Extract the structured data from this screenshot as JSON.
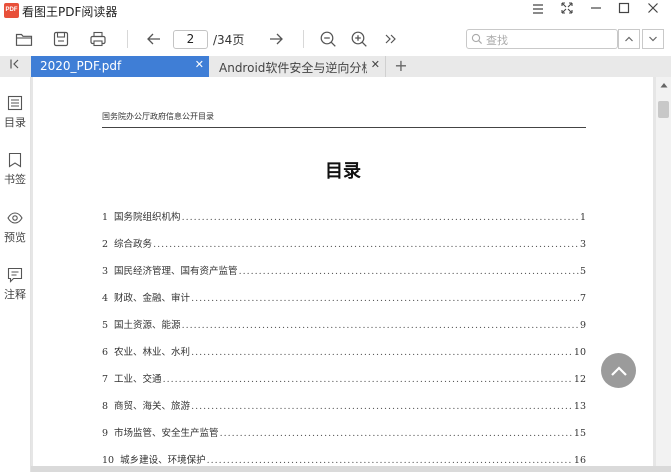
{
  "app": {
    "logo_text": "PDF",
    "title": "看图王PDF阅读器",
    "window_controls": [
      "menu-icon",
      "fullscreen-icon",
      "minimize-icon",
      "maximize-icon",
      "close-icon"
    ]
  },
  "toolbar": {
    "buttons": [
      "open-folder-icon",
      "save-icon",
      "print-icon",
      "prev-page-icon",
      "next-page-icon",
      "zoom-out-icon",
      "zoom-in-icon",
      "more-icon"
    ],
    "current_page": "2",
    "total_pages": "/34页",
    "search_placeholder": "查找"
  },
  "tabs": [
    {
      "label": "2020_PDF.pdf",
      "active": true
    },
    {
      "label": "Android软件安全与逆向分析.pdf",
      "active": false
    }
  ],
  "sidebar": {
    "items": [
      {
        "label": "目录",
        "icon": "toc-icon"
      },
      {
        "label": "书签",
        "icon": "bookmark-icon"
      },
      {
        "label": "预览",
        "icon": "eye-icon"
      },
      {
        "label": "注释",
        "icon": "comment-icon"
      }
    ]
  },
  "document": {
    "header": "国务院办公厅政府信息公开目录",
    "title": "目录",
    "toc": [
      {
        "num": "1",
        "text": "国务院组织机构",
        "page": "1"
      },
      {
        "num": "2",
        "text": "综合政务",
        "page": "3"
      },
      {
        "num": "3",
        "text": "国民经济管理、国有资产监管",
        "page": "5"
      },
      {
        "num": "4",
        "text": "财政、金融、审计",
        "page": "7"
      },
      {
        "num": "5",
        "text": "国土资源、能源",
        "page": "9"
      },
      {
        "num": "6",
        "text": "农业、林业、水利",
        "page": "10"
      },
      {
        "num": "7",
        "text": "工业、交通",
        "page": "12"
      },
      {
        "num": "8",
        "text": "商贸、海关、旅游",
        "page": "13"
      },
      {
        "num": "9",
        "text": "市场监管、安全生产监管",
        "page": "15"
      },
      {
        "num": "10",
        "text": "城乡建设、环境保护",
        "page": "16"
      }
    ]
  },
  "colors": {
    "accent": "#3f7ed6",
    "logo": "#e8503a",
    "back_to_top": "#8a8a8a"
  }
}
